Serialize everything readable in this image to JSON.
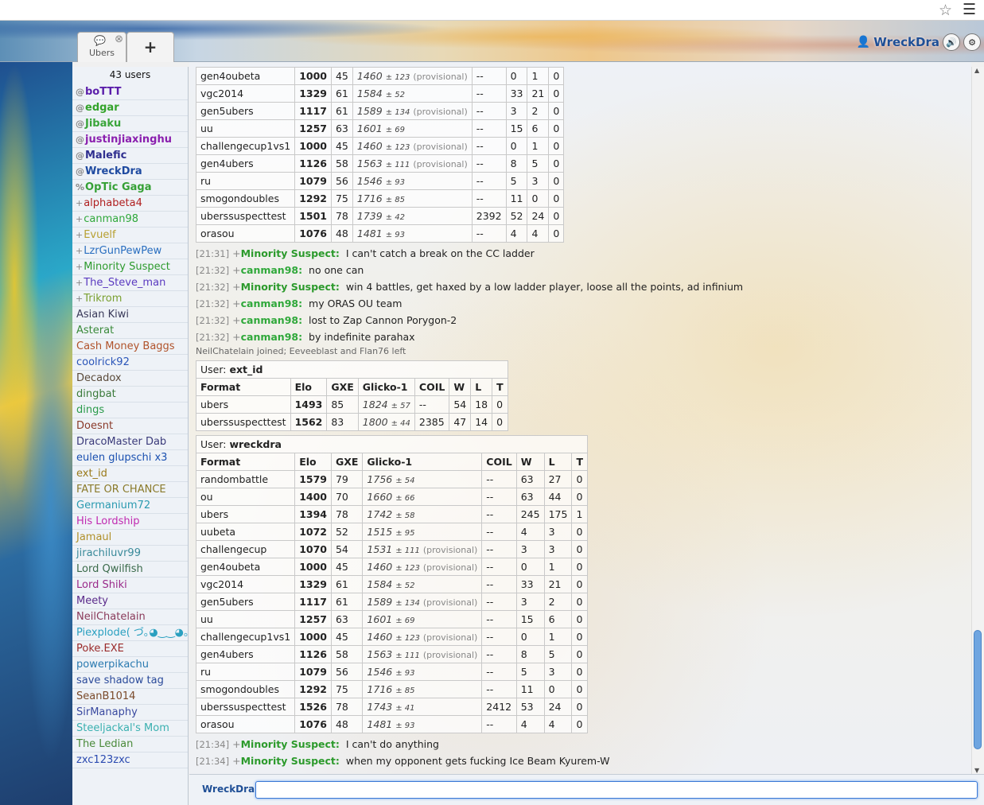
{
  "header": {
    "tab_room": "Ubers",
    "tab_add": "+",
    "username": "WreckDra",
    "icons": {
      "chat": "speech-bubble-icon",
      "close": "close-icon",
      "user": "user-icon",
      "sound": "speaker-icon",
      "settings": "gear-icon",
      "star": "star-icon",
      "menu": "hamburger-menu-icon"
    }
  },
  "userlist": {
    "count": "43 users",
    "users": [
      {
        "grp": "@",
        "name": "boTTT",
        "color": "#5b1eaa",
        "bold": true
      },
      {
        "grp": "@",
        "name": "edgar",
        "color": "#33a32a",
        "bold": true
      },
      {
        "grp": "@",
        "name": "Jibaku",
        "color": "#3aa53a",
        "bold": true
      },
      {
        "grp": "@",
        "name": "justinjiaxinghu",
        "color": "#8a1fae",
        "bold": true
      },
      {
        "grp": "@",
        "name": "Malefic",
        "color": "#2f2f8f",
        "bold": true
      },
      {
        "grp": "@",
        "name": "WreckDra",
        "color": "#1e4aa0",
        "bold": true
      },
      {
        "grp": "%",
        "name": "OpTic Gaga",
        "color": "#35a035",
        "bold": true
      },
      {
        "grp": "+",
        "name": "alphabeta4",
        "color": "#b02020",
        "bold": false
      },
      {
        "grp": "+",
        "name": "canman98",
        "color": "#2fa83a",
        "bold": false
      },
      {
        "grp": "+",
        "name": "Evuelf",
        "color": "#b7a030",
        "bold": false
      },
      {
        "grp": "+",
        "name": "LzrGunPewPew",
        "color": "#2a6fc0",
        "bold": false
      },
      {
        "grp": "+",
        "name": "Minority Suspect",
        "color": "#2c9a2c",
        "bold": false
      },
      {
        "grp": "+",
        "name": "The_Steve_man",
        "color": "#5a3ac0",
        "bold": false
      },
      {
        "grp": "+",
        "name": "Trikrom",
        "color": "#7aa030",
        "bold": false
      },
      {
        "grp": "",
        "name": "Asian Kiwi",
        "color": "#3a3a5a",
        "bold": false
      },
      {
        "grp": "",
        "name": "Asterat",
        "color": "#3a8a3a",
        "bold": false
      },
      {
        "grp": "",
        "name": "Cash Money Baggs",
        "color": "#b0522a",
        "bold": false
      },
      {
        "grp": "",
        "name": "coolrick92",
        "color": "#2a55b8",
        "bold": false
      },
      {
        "grp": "",
        "name": "Decadox",
        "color": "#5a4a3a",
        "bold": false
      },
      {
        "grp": "",
        "name": "dingbat",
        "color": "#3a7a3a",
        "bold": false
      },
      {
        "grp": "",
        "name": "dings",
        "color": "#2a9a4a",
        "bold": false
      },
      {
        "grp": "",
        "name": "Doesnt",
        "color": "#8a3a2a",
        "bold": false
      },
      {
        "grp": "",
        "name": "DracoMaster Dab",
        "color": "#3a3a7a",
        "bold": false
      },
      {
        "grp": "",
        "name": "eulen glupschi x3",
        "color": "#1a50b0",
        "bold": false
      },
      {
        "grp": "",
        "name": "ext_id",
        "color": "#9a7a1a",
        "bold": false
      },
      {
        "grp": "",
        "name": "FATE OR CHANCE",
        "color": "#8a7a2a",
        "bold": false
      },
      {
        "grp": "",
        "name": "Germanium72",
        "color": "#2a9ab0",
        "bold": false
      },
      {
        "grp": "",
        "name": "His Lordship",
        "color": "#c02ab0",
        "bold": false
      },
      {
        "grp": "",
        "name": "Jamaul",
        "color": "#b0902a",
        "bold": false
      },
      {
        "grp": "",
        "name": "jirachiluvr99",
        "color": "#3a8a9a",
        "bold": false
      },
      {
        "grp": "",
        "name": "Lord Qwilfish",
        "color": "#3a6a4a",
        "bold": false
      },
      {
        "grp": "",
        "name": "Lord Shiki",
        "color": "#9a2a8a",
        "bold": false
      },
      {
        "grp": "",
        "name": "Meety",
        "color": "#5a2a8a",
        "bold": false
      },
      {
        "grp": "",
        "name": "NeilChatelain",
        "color": "#8a3a5a",
        "bold": false
      },
      {
        "grp": "",
        "name": "Piexplode( づ｡◕‿‿◕｡)づ",
        "color": "#2aa0c0",
        "bold": false
      },
      {
        "grp": "",
        "name": "Poke.EXE",
        "color": "#9a2a2a",
        "bold": false
      },
      {
        "grp": "",
        "name": "powerpikachu",
        "color": "#2a7ab0",
        "bold": false
      },
      {
        "grp": "",
        "name": "save shadow tag",
        "color": "#2a4a9a",
        "bold": false
      },
      {
        "grp": "",
        "name": "SeanB1014",
        "color": "#7a4a2a",
        "bold": false
      },
      {
        "grp": "",
        "name": "SirManaphy",
        "color": "#3a4aa0",
        "bold": false
      },
      {
        "grp": "",
        "name": "Steeljackal's Mom",
        "color": "#3ab0b0",
        "bold": false
      },
      {
        "grp": "",
        "name": "The Ledian",
        "color": "#4a8a3a",
        "bold": false
      },
      {
        "grp": "",
        "name": "zxc123zxc",
        "color": "#2a4ab0",
        "bold": false
      }
    ]
  },
  "chat": {
    "table1": {
      "rows": [
        {
          "format": "gen4oubeta",
          "elo": "1000",
          "gxe": "45",
          "gl": "1460",
          "dev": "± 123",
          "prov": "(provisional)",
          "coil": "--",
          "w": "0",
          "l": "1",
          "t": "0"
        },
        {
          "format": "vgc2014",
          "elo": "1329",
          "gxe": "61",
          "gl": "1584",
          "dev": "± 52",
          "prov": "",
          "coil": "--",
          "w": "33",
          "l": "21",
          "t": "0"
        },
        {
          "format": "gen5ubers",
          "elo": "1117",
          "gxe": "61",
          "gl": "1589",
          "dev": "± 134",
          "prov": "(provisional)",
          "coil": "--",
          "w": "3",
          "l": "2",
          "t": "0"
        },
        {
          "format": "uu",
          "elo": "1257",
          "gxe": "63",
          "gl": "1601",
          "dev": "± 69",
          "prov": "",
          "coil": "--",
          "w": "15",
          "l": "6",
          "t": "0"
        },
        {
          "format": "challengecup1vs1",
          "elo": "1000",
          "gxe": "45",
          "gl": "1460",
          "dev": "± 123",
          "prov": "(provisional)",
          "coil": "--",
          "w": "0",
          "l": "1",
          "t": "0"
        },
        {
          "format": "gen4ubers",
          "elo": "1126",
          "gxe": "58",
          "gl": "1563",
          "dev": "± 111",
          "prov": "(provisional)",
          "coil": "--",
          "w": "8",
          "l": "5",
          "t": "0"
        },
        {
          "format": "ru",
          "elo": "1079",
          "gxe": "56",
          "gl": "1546",
          "dev": "± 93",
          "prov": "",
          "coil": "--",
          "w": "5",
          "l": "3",
          "t": "0"
        },
        {
          "format": "smogondoubles",
          "elo": "1292",
          "gxe": "75",
          "gl": "1716",
          "dev": "± 85",
          "prov": "",
          "coil": "--",
          "w": "11",
          "l": "0",
          "t": "0"
        },
        {
          "format": "uberssuspecttest",
          "elo": "1501",
          "gxe": "78",
          "gl": "1739",
          "dev": "± 42",
          "prov": "",
          "coil": "2392",
          "w": "52",
          "l": "24",
          "t": "0"
        },
        {
          "format": "orasou",
          "elo": "1076",
          "gxe": "48",
          "gl": "1481",
          "dev": "± 93",
          "prov": "",
          "coil": "--",
          "w": "4",
          "l": "4",
          "t": "0"
        }
      ]
    },
    "messages1": [
      {
        "time": "[21:31]",
        "rank": "+",
        "who": "Minority Suspect:",
        "text": "I can't catch a break on the CC ladder",
        "color": "#2c9a2c"
      },
      {
        "time": "[21:32]",
        "rank": "+",
        "who": "canman98:",
        "text": "no one can",
        "color": "#2fa83a"
      },
      {
        "time": "[21:32]",
        "rank": "+",
        "who": "Minority Suspect:",
        "text": "win 4 battles, get haxed by a low ladder player, loose all the points, ad infinium",
        "color": "#2c9a2c"
      },
      {
        "time": "[21:32]",
        "rank": "+",
        "who": "canman98:",
        "text": "my ORAS OU team",
        "color": "#2fa83a"
      },
      {
        "time": "[21:32]",
        "rank": "+",
        "who": "canman98:",
        "text": "lost to Zap Cannon Porygon-2",
        "color": "#2fa83a"
      },
      {
        "time": "[21:32]",
        "rank": "+",
        "who": "canman98:",
        "text": "by indefinite parahax",
        "color": "#2fa83a"
      }
    ],
    "notice": "NeilChatelain joined; Eeveeblast and Flan76 left",
    "table_headers": {
      "format": "Format",
      "elo": "Elo",
      "gxe": "GXE",
      "glicko": "Glicko-1",
      "coil": "COIL",
      "w": "W",
      "l": "L",
      "t": "T"
    },
    "table2": {
      "user_label": "User:",
      "user": "ext_id",
      "rows": [
        {
          "format": "ubers",
          "elo": "1493",
          "gxe": "85",
          "gl": "1824",
          "dev": "± 57",
          "prov": "",
          "coil": "--",
          "w": "54",
          "l": "18",
          "t": "0"
        },
        {
          "format": "uberssuspecttest",
          "elo": "1562",
          "gxe": "83",
          "gl": "1800",
          "dev": "± 44",
          "prov": "",
          "coil": "2385",
          "w": "47",
          "l": "14",
          "t": "0"
        }
      ]
    },
    "table3": {
      "user_label": "User:",
      "user": "wreckdra",
      "rows": [
        {
          "format": "randombattle",
          "elo": "1579",
          "gxe": "79",
          "gl": "1756",
          "dev": "± 54",
          "prov": "",
          "coil": "--",
          "w": "63",
          "l": "27",
          "t": "0"
        },
        {
          "format": "ou",
          "elo": "1400",
          "gxe": "70",
          "gl": "1660",
          "dev": "± 66",
          "prov": "",
          "coil": "--",
          "w": "63",
          "l": "44",
          "t": "0"
        },
        {
          "format": "ubers",
          "elo": "1394",
          "gxe": "78",
          "gl": "1742",
          "dev": "± 58",
          "prov": "",
          "coil": "--",
          "w": "245",
          "l": "175",
          "t": "1"
        },
        {
          "format": "uubeta",
          "elo": "1072",
          "gxe": "52",
          "gl": "1515",
          "dev": "± 95",
          "prov": "",
          "coil": "--",
          "w": "4",
          "l": "3",
          "t": "0"
        },
        {
          "format": "challengecup",
          "elo": "1070",
          "gxe": "54",
          "gl": "1531",
          "dev": "± 111",
          "prov": "(provisional)",
          "coil": "--",
          "w": "3",
          "l": "3",
          "t": "0"
        },
        {
          "format": "gen4oubeta",
          "elo": "1000",
          "gxe": "45",
          "gl": "1460",
          "dev": "± 123",
          "prov": "(provisional)",
          "coil": "--",
          "w": "0",
          "l": "1",
          "t": "0"
        },
        {
          "format": "vgc2014",
          "elo": "1329",
          "gxe": "61",
          "gl": "1584",
          "dev": "± 52",
          "prov": "",
          "coil": "--",
          "w": "33",
          "l": "21",
          "t": "0"
        },
        {
          "format": "gen5ubers",
          "elo": "1117",
          "gxe": "61",
          "gl": "1589",
          "dev": "± 134",
          "prov": "(provisional)",
          "coil": "--",
          "w": "3",
          "l": "2",
          "t": "0"
        },
        {
          "format": "uu",
          "elo": "1257",
          "gxe": "63",
          "gl": "1601",
          "dev": "± 69",
          "prov": "",
          "coil": "--",
          "w": "15",
          "l": "6",
          "t": "0"
        },
        {
          "format": "challengecup1vs1",
          "elo": "1000",
          "gxe": "45",
          "gl": "1460",
          "dev": "± 123",
          "prov": "(provisional)",
          "coil": "--",
          "w": "0",
          "l": "1",
          "t": "0"
        },
        {
          "format": "gen4ubers",
          "elo": "1126",
          "gxe": "58",
          "gl": "1563",
          "dev": "± 111",
          "prov": "(provisional)",
          "coil": "--",
          "w": "8",
          "l": "5",
          "t": "0"
        },
        {
          "format": "ru",
          "elo": "1079",
          "gxe": "56",
          "gl": "1546",
          "dev": "± 93",
          "prov": "",
          "coil": "--",
          "w": "5",
          "l": "3",
          "t": "0"
        },
        {
          "format": "smogondoubles",
          "elo": "1292",
          "gxe": "75",
          "gl": "1716",
          "dev": "± 85",
          "prov": "",
          "coil": "--",
          "w": "11",
          "l": "0",
          "t": "0"
        },
        {
          "format": "uberssuspecttest",
          "elo": "1526",
          "gxe": "78",
          "gl": "1743",
          "dev": "± 41",
          "prov": "",
          "coil": "2412",
          "w": "53",
          "l": "24",
          "t": "0"
        },
        {
          "format": "orasou",
          "elo": "1076",
          "gxe": "48",
          "gl": "1481",
          "dev": "± 93",
          "prov": "",
          "coil": "--",
          "w": "4",
          "l": "4",
          "t": "0"
        }
      ]
    },
    "messages2": [
      {
        "time": "[21:34]",
        "rank": "+",
        "who": "Minority Suspect:",
        "text": "I can't do anything",
        "color": "#2c9a2c"
      },
      {
        "time": "[21:34]",
        "rank": "+",
        "who": "Minority Suspect:",
        "text": "when my opponent gets fucking Ice Beam Kyurem-W",
        "color": "#2c9a2c"
      }
    ]
  },
  "input": {
    "label": "WreckDra:",
    "value": "",
    "placeholder": ""
  }
}
